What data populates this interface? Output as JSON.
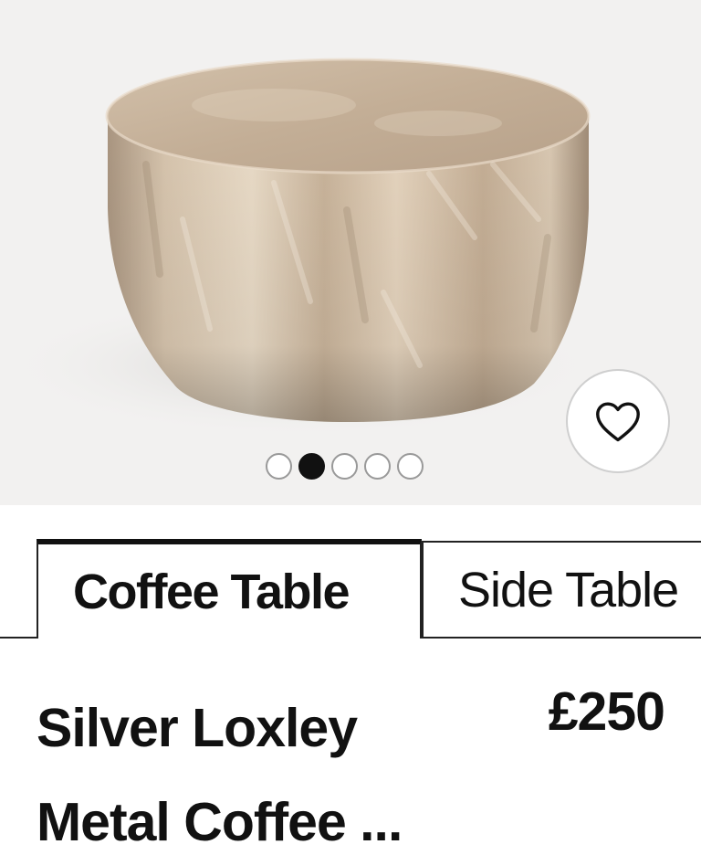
{
  "gallery": {
    "image_alt": "Silver Loxley Metal Coffee Table",
    "wishlist_icon": "heart-outline-icon",
    "dots_total": 5,
    "active_dot": 2
  },
  "tabs": [
    {
      "label": "Coffee Table",
      "selected": true
    },
    {
      "label": "Side Table",
      "selected": false
    }
  ],
  "product": {
    "name_line1": "Silver Loxley",
    "name_line2": "Metal Coffee ...",
    "price": "£250"
  },
  "colors": {
    "text": "#111111",
    "gallery_bg": "#f2f1f0",
    "metal": "#c9b49d"
  }
}
